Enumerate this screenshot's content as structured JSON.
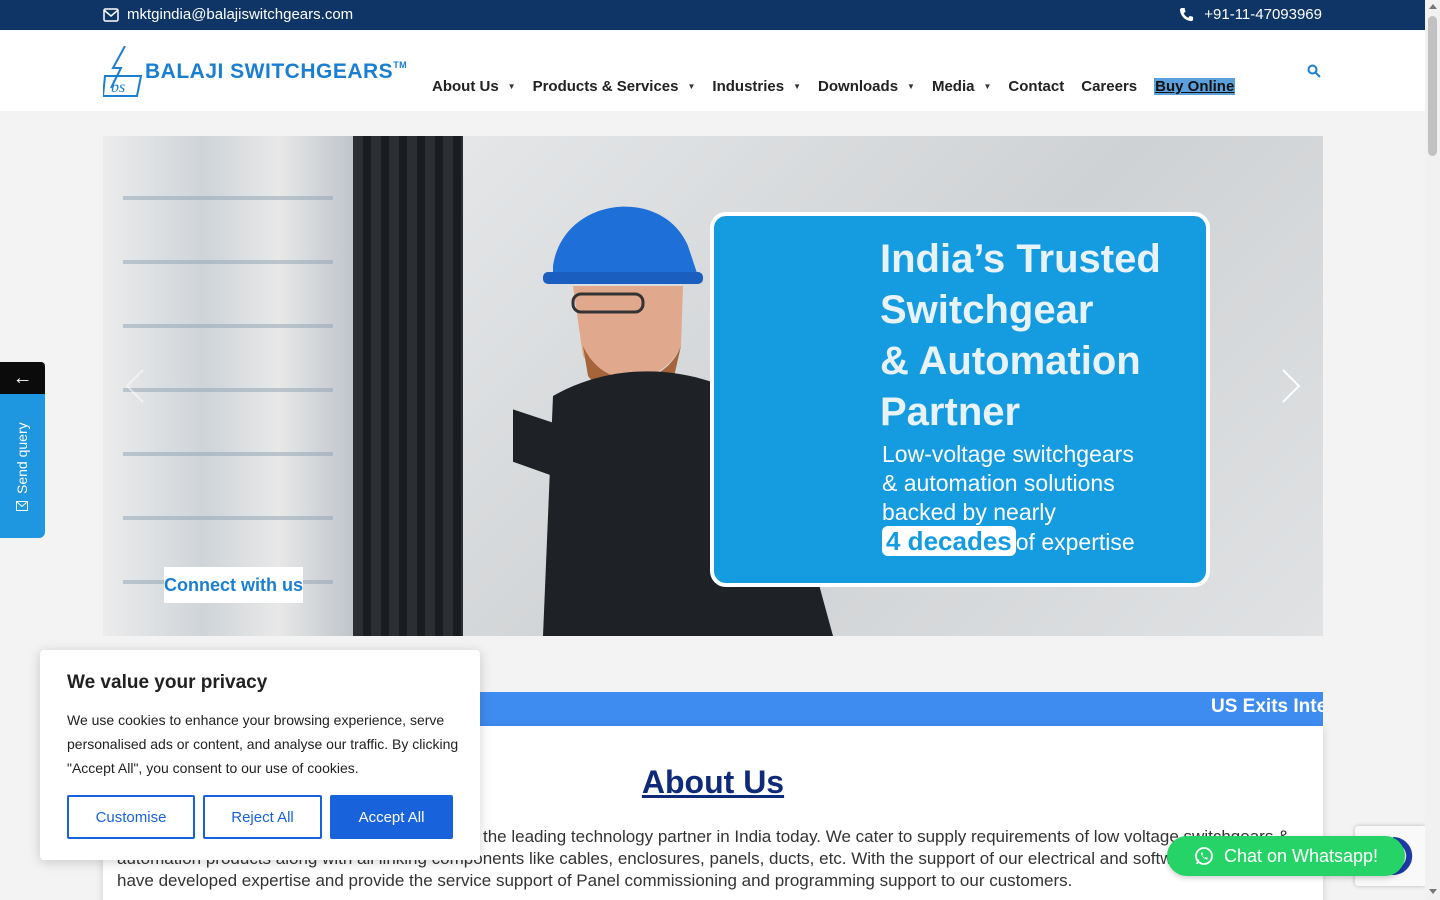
{
  "topbar": {
    "email": "mktgindia@balajiswitchgears.com",
    "phone": "+91-11-47093969"
  },
  "header": {
    "logo_text": "BALAJI SWITCHGEARS",
    "logo_tm": "TM",
    "logo_mark": "bs",
    "nav": [
      {
        "label": "About Us",
        "has_dropdown": true
      },
      {
        "label": "Products & Services",
        "has_dropdown": true
      },
      {
        "label": "Industries",
        "has_dropdown": true
      },
      {
        "label": "Downloads",
        "has_dropdown": true
      },
      {
        "label": "Media",
        "has_dropdown": true
      },
      {
        "label": "Contact",
        "has_dropdown": false
      },
      {
        "label": "Careers",
        "has_dropdown": false
      },
      {
        "label": "Buy Online",
        "has_dropdown": false
      }
    ],
    "search_icon": "search-icon"
  },
  "hero": {
    "headline_lines": [
      "India’s Trusted",
      "Switchgear",
      "& Automation",
      "Partner"
    ],
    "sub_line1": "Low-voltage switchgears",
    "sub_line2": "& automation solutions",
    "sub_line3": "backed by nearly",
    "highlight": "4 decades",
    "sub_tail": "of expertise",
    "cta": "Connect with us"
  },
  "side_tab": {
    "back_arrow": "←",
    "label": "Send query"
  },
  "ticker": {
    "text": "US Exits Inter"
  },
  "about": {
    "title": "About Us",
    "line1_visible": "is the leading technology partner in India today. We cater to supply requirements of low voltage switchgears &",
    "line2_visible": "automation products along with all linking components like cables, enclosures, panels, ducts, etc. With the support of our electrical and softw",
    "line3": "have developed expertise and provide the service support of Panel commissioning and programming support to our customers."
  },
  "cookie": {
    "title": "We value your privacy",
    "body": "We use cookies to enhance your browsing experience, serve personalised ads or content, and analyse our traffic. By clicking \"Accept All\", you consent to our use of cookies.",
    "customise": "Customise",
    "reject": "Reject All",
    "accept": "Accept All"
  },
  "whatsapp": {
    "label": "Chat on Whatsapp!"
  },
  "colors": {
    "topbar": "#0e3565",
    "brand_blue": "#1a7fd1",
    "card_blue": "#159be0",
    "ticker": "#3f8cf0",
    "cookie_primary": "#1863dc",
    "whatsapp": "#25d366"
  }
}
